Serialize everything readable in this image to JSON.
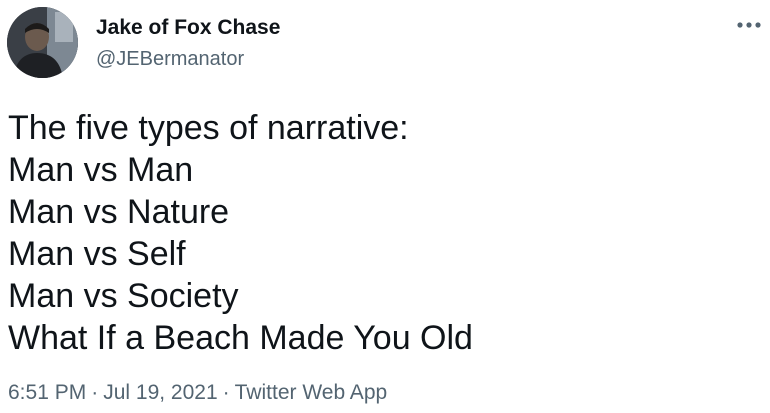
{
  "author": {
    "display_name": "Jake of Fox Chase",
    "handle": "@JEBermanator"
  },
  "tweet": {
    "lines": [
      "The five types of narrative:",
      "Man vs Man",
      "Man vs Nature",
      "Man vs Self",
      "Man vs Society",
      "What If a Beach Made You Old"
    ]
  },
  "meta": {
    "time": "6:51 PM",
    "separator": "·",
    "date": "Jul 19, 2021",
    "source": "Twitter Web App"
  },
  "icons": {
    "more": "more-horizontal-icon",
    "avatar": "profile-avatar"
  },
  "colors": {
    "text_primary": "#0f1419",
    "text_secondary": "#536471"
  }
}
